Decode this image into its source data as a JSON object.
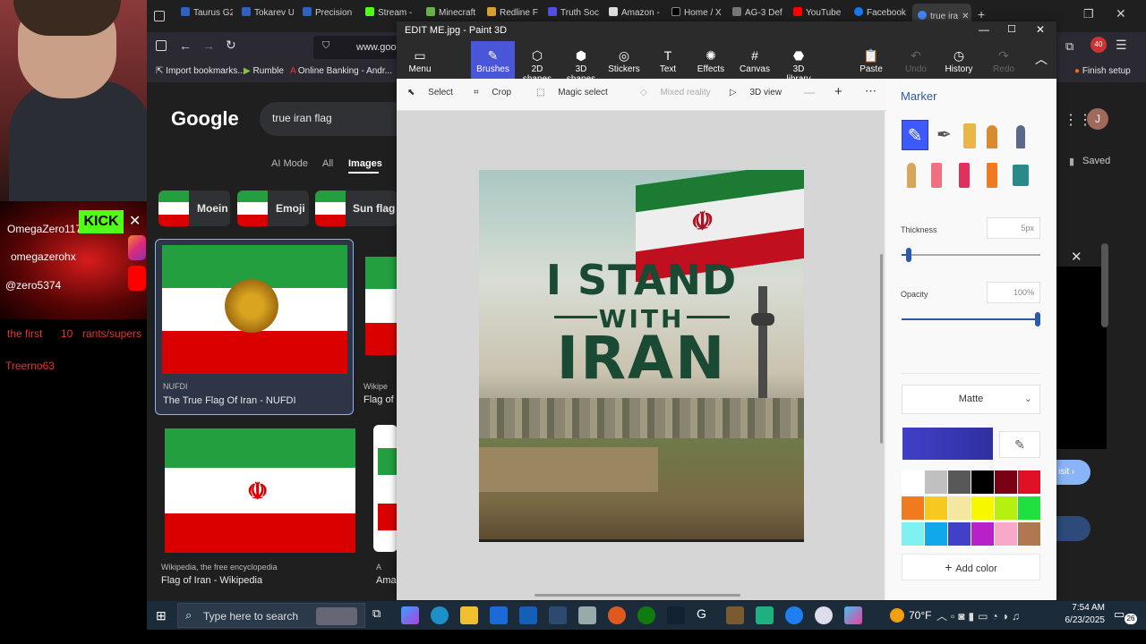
{
  "stream": {
    "names": [
      "OmegaZero117",
      "omegazerohx",
      "@zero5374"
    ],
    "kick_label": "KICK",
    "ticker": [
      "the first",
      "10",
      "rants/supers"
    ],
    "user": "Treerno63"
  },
  "browser": {
    "tabs": [
      "Taurus G2",
      "Tokarev U",
      "Precision",
      "Stream -",
      "Minecraft",
      "Redline F",
      "Truth Soc",
      "Amazon -",
      "Home / X",
      "AG-3 Def",
      "YouTube",
      "Facebook",
      "true ira"
    ],
    "url": "www.goog",
    "bookmarks": [
      "Import bookmarks...",
      "Rumble",
      "Online Banking - Andr..."
    ],
    "bookmark_right": "Finish setup",
    "ext_badge": "40"
  },
  "google": {
    "logo": "Google",
    "query": "true iran flag",
    "nav": [
      "AI Mode",
      "All",
      "Images"
    ],
    "chips": [
      "Moein",
      "Emoji",
      "Sun flag e"
    ],
    "results": [
      {
        "source": "NUFDI",
        "title": "The True Flag Of Iran - NUFDI"
      },
      {
        "source": "Wikipe",
        "title": "Flag of I"
      },
      {
        "source": "Wikipedia, the free encyclopedia",
        "title": "Flag of Iran - Wikipedia"
      },
      {
        "source": "A",
        "title": "Ama"
      }
    ],
    "saved": "Saved",
    "avatar": "J",
    "visit": "isit"
  },
  "paint3d": {
    "title": "EDIT ME.jpg - Paint 3D",
    "ribbon": [
      "Menu",
      "Brushes",
      "2D shapes",
      "3D shapes",
      "Stickers",
      "Text",
      "Effects",
      "Canvas",
      "3D library",
      "Paste",
      "Undo",
      "History",
      "Redo"
    ],
    "toolbar": [
      "Select",
      "Crop",
      "Magic select",
      "Mixed reality",
      "3D view"
    ],
    "poster": {
      "line1": "I STAND",
      "line2": "WITH",
      "line3": "IRAN"
    },
    "panel": {
      "title": "Marker",
      "thickness_label": "Thickness",
      "thickness_value": "5px",
      "thickness_fraction": 0.05,
      "opacity_label": "Opacity",
      "opacity_value": "100%",
      "opacity_fraction": 1.0,
      "finish": "Matte",
      "add_color": "Add color",
      "selected_color": "#4040c8",
      "palette": [
        "#ffffff",
        "#c0c0c0",
        "#585858",
        "#000000",
        "#7a0014",
        "#e01025",
        "#f07a20",
        "#f7c820",
        "#f5e6a0",
        "#f7f700",
        "#b6f010",
        "#20e040",
        "#80f0f0",
        "#10a8e8",
        "#4040c8",
        "#b820c8",
        "#f8a8c8",
        "#b07850"
      ]
    }
  },
  "taskbar": {
    "search": "Type here to search",
    "weather": "70°F",
    "time": "7:54 AM",
    "date": "6/23/2025",
    "notif": "26"
  }
}
